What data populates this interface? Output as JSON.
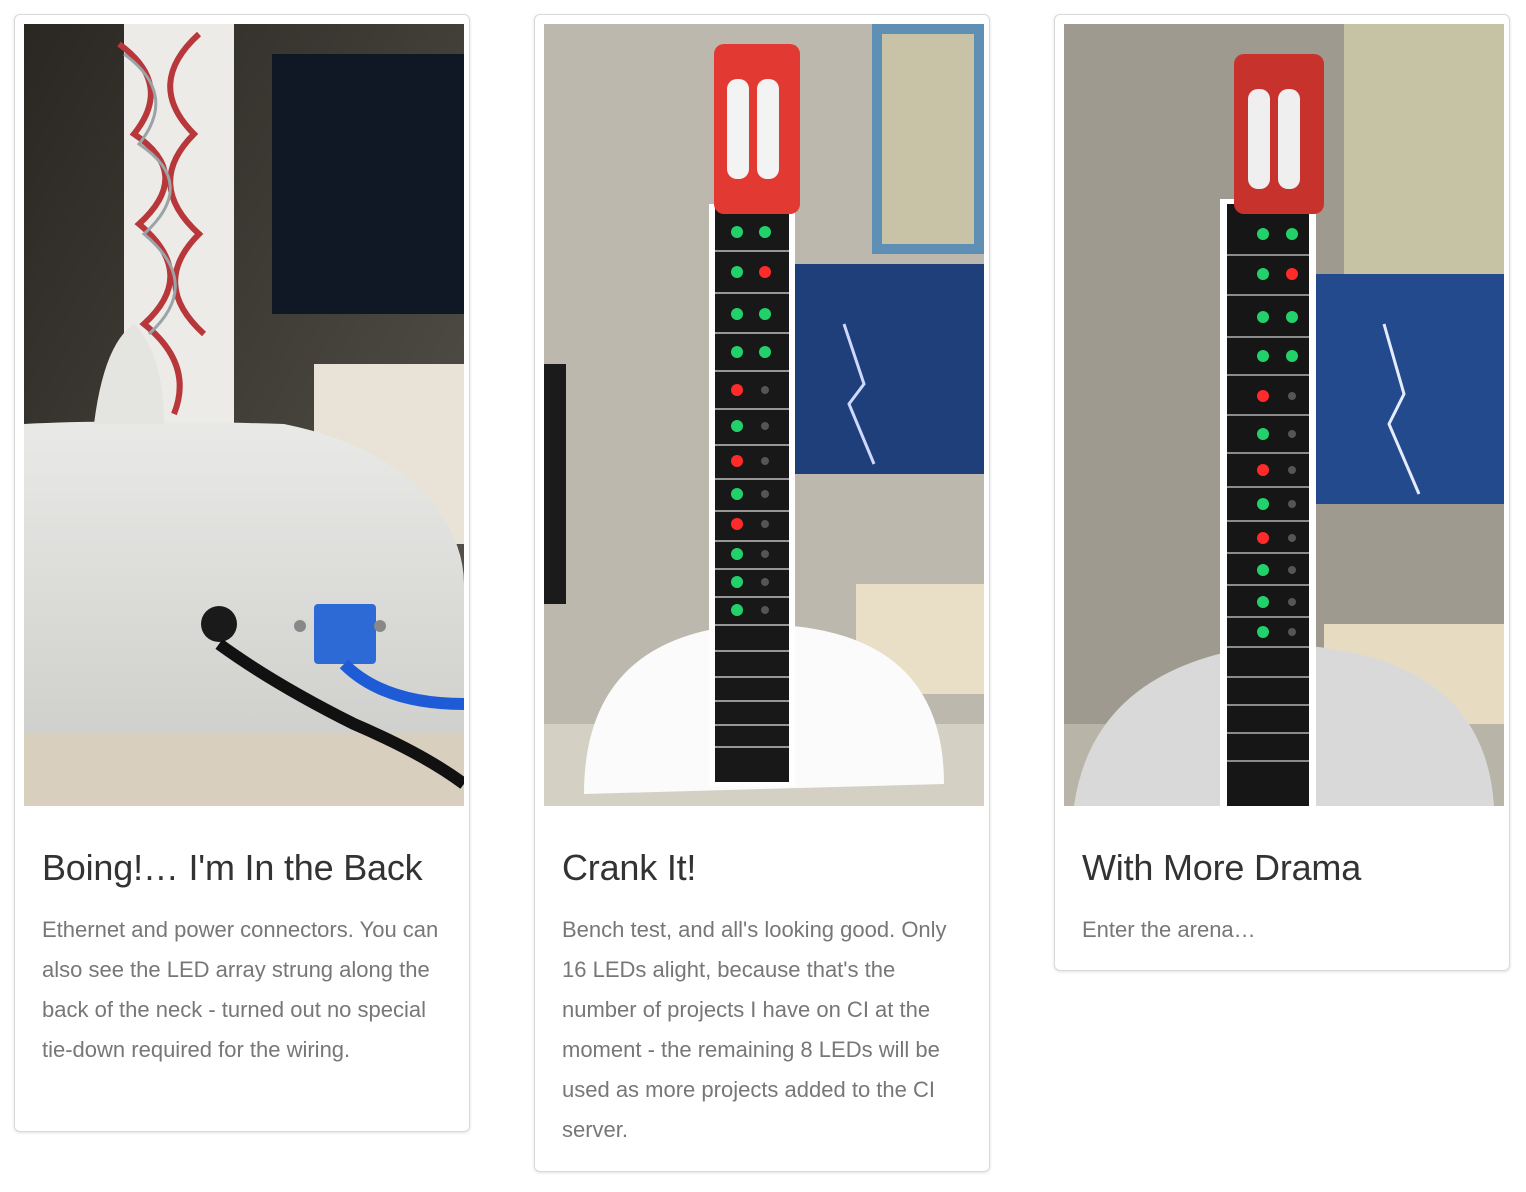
{
  "cards": [
    {
      "title": "Boing!… I'm In the Back",
      "description": "Ethernet and power connectors. You can also see the LED array strung along the back of the neck - turned out no special tie-down required for the wiring.",
      "image_icon": "guitar-back-photo"
    },
    {
      "title": "Crank It!",
      "description": "Bench test, and all's looking good. Only 16 LEDs alight, because that's the number of projects I have on CI at the moment - the remaining 8 LEDs will be used as more projects added to the CI server.",
      "image_icon": "guitar-front-photo"
    },
    {
      "title": "With More Drama",
      "description": "Enter the arena…",
      "image_icon": "guitar-drama-photo"
    }
  ],
  "colors": {
    "led_green": "#22d16a",
    "led_red": "#ff2a2a",
    "headstock_red": "#e23a33"
  }
}
